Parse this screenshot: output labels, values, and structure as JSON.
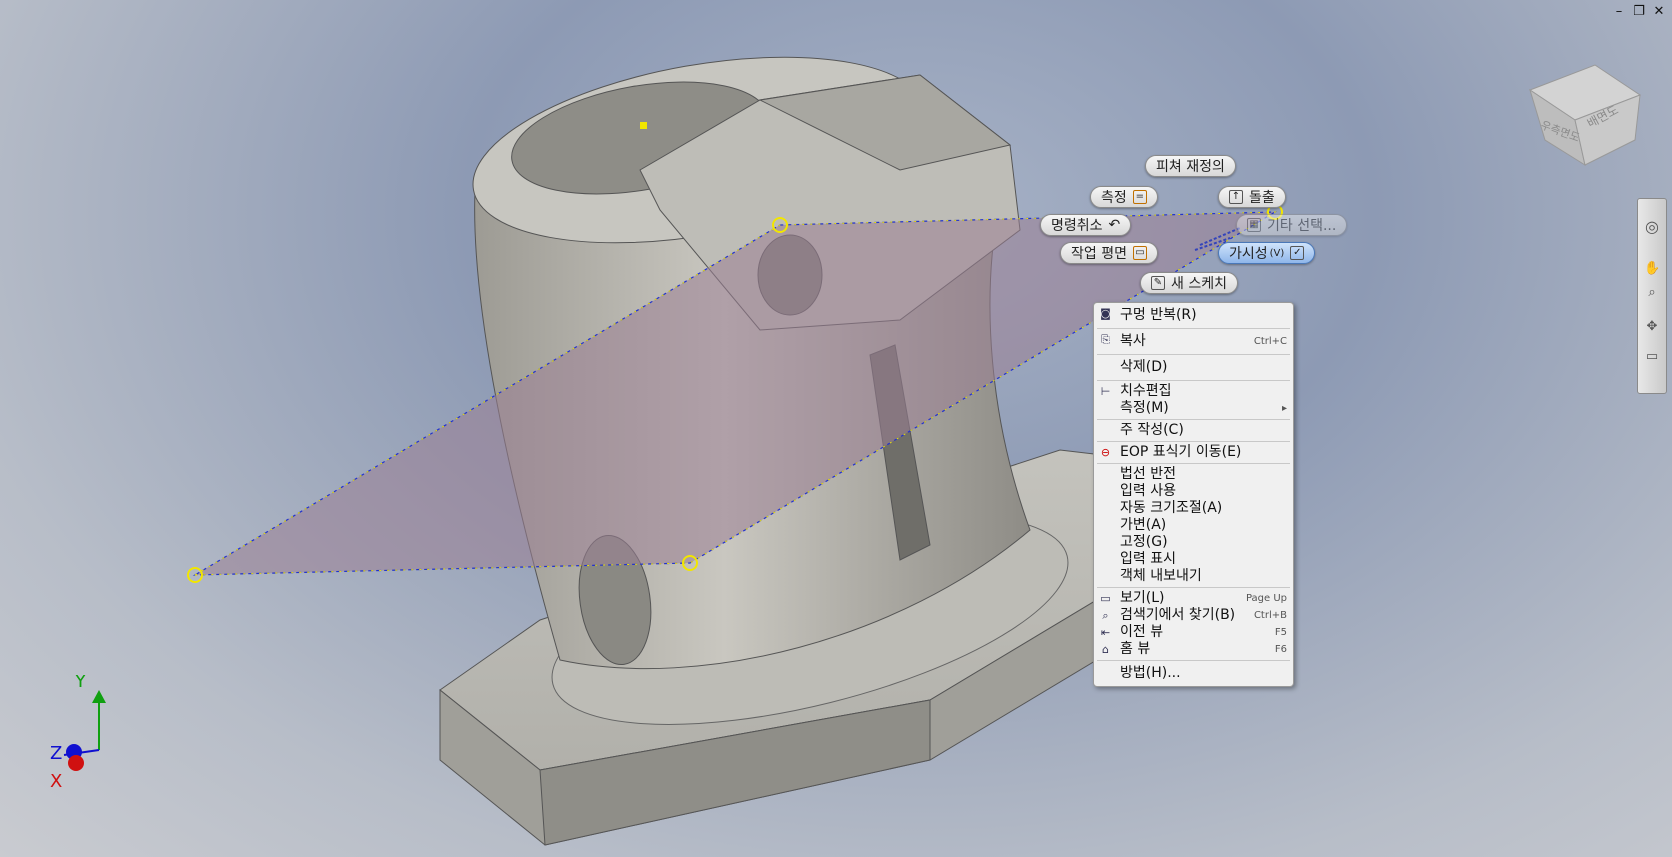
{
  "window_controls": {
    "minimize": "–",
    "restore": "❐",
    "close": "✕"
  },
  "viewcube": {
    "face_right": "우측면도",
    "face_back": "배면도"
  },
  "marking_menu": {
    "redefine_feature": "피쳐 재정의",
    "measure": "측정",
    "extrude": "돌출",
    "cancel_command": "명령취소",
    "select_other": "기타 선택...",
    "work_plane": "작업 평면",
    "visibility": "가시성",
    "visibility_shortcut": "(V)",
    "new_sketch": "새 스케치"
  },
  "context_menu": {
    "items": [
      {
        "label": "구멍 반복(R)",
        "shortcut": "",
        "icon": "repeat-hole-icon"
      },
      {
        "label": "복사",
        "shortcut": "Ctrl+C",
        "icon": "copy-icon"
      },
      {
        "label": "삭제(D)",
        "shortcut": "",
        "icon": ""
      },
      {
        "label": "치수편집",
        "shortcut": "",
        "icon": "edit-dimension-icon"
      },
      {
        "label": "측정(M)",
        "shortcut": "▸",
        "icon": ""
      },
      {
        "label": "주 작성(C)",
        "shortcut": "",
        "icon": ""
      },
      {
        "label": "EOP 표식기 이동(E)",
        "shortcut": "",
        "icon": "eop-marker-icon"
      },
      {
        "label": "법선 반전",
        "shortcut": "",
        "icon": ""
      },
      {
        "label": "입력 사용",
        "shortcut": "",
        "icon": ""
      },
      {
        "label": "자동 크기조절(A)",
        "shortcut": "",
        "icon": ""
      },
      {
        "label": "가변(A)",
        "shortcut": "",
        "icon": ""
      },
      {
        "label": "고정(G)",
        "shortcut": "",
        "icon": ""
      },
      {
        "label": "입력 표시",
        "shortcut": "",
        "icon": ""
      },
      {
        "label": "객체 내보내기",
        "shortcut": "",
        "icon": ""
      },
      {
        "label": "보기(L)",
        "shortcut": "Page Up",
        "icon": "view-icon"
      },
      {
        "label": "검색기에서 찾기(B)",
        "shortcut": "Ctrl+B",
        "icon": "find-in-browser-icon"
      },
      {
        "label": "이전 뷰",
        "shortcut": "F5",
        "icon": "previous-view-icon"
      },
      {
        "label": "홈 뷰",
        "shortcut": "F6",
        "icon": "home-view-icon"
      },
      {
        "label": "방법(H)...",
        "shortcut": "",
        "icon": ""
      }
    ]
  },
  "axis_triad": {
    "y": "Y",
    "z": "Z",
    "x": "X"
  },
  "colors": {
    "plane_fill": "#9a7f94",
    "handle": "#f2e600",
    "axis_x": "#d01010",
    "axis_y": "#10a010",
    "axis_z": "#1010d0"
  }
}
